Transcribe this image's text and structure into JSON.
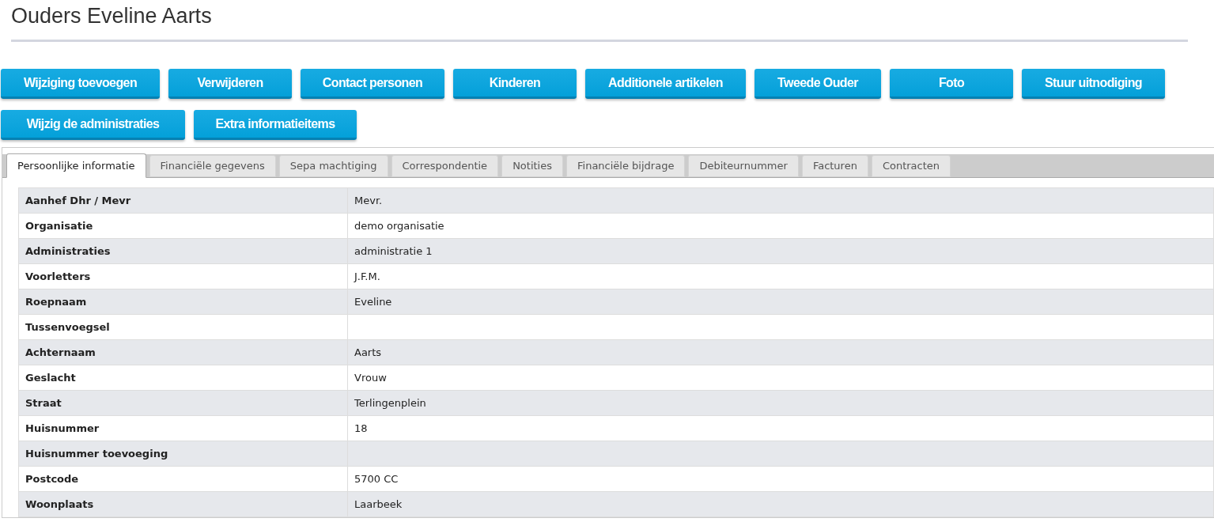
{
  "page": {
    "title": "Ouders Eveline Aarts"
  },
  "actions": [
    {
      "label": "Wijziging toevoegen"
    },
    {
      "label": "Verwijderen"
    },
    {
      "label": "Contact personen"
    },
    {
      "label": "Kinderen"
    },
    {
      "label": "Additionele artikelen"
    },
    {
      "label": "Tweede Ouder"
    },
    {
      "label": "Foto"
    },
    {
      "label": "Stuur uitnodiging"
    },
    {
      "label": "Wijzig de administraties"
    },
    {
      "label": "Extra informatieitems"
    }
  ],
  "tabs": [
    {
      "label": "Persoonlijke informatie",
      "selected": true
    },
    {
      "label": "Financiële gegevens",
      "selected": false
    },
    {
      "label": "Sepa machtiging",
      "selected": false
    },
    {
      "label": "Correspondentie",
      "selected": false
    },
    {
      "label": "Notities",
      "selected": false
    },
    {
      "label": "Financiële bijdrage",
      "selected": false
    },
    {
      "label": "Debiteurnummer",
      "selected": false
    },
    {
      "label": "Facturen",
      "selected": false
    },
    {
      "label": "Contracten",
      "selected": false
    }
  ],
  "details": [
    {
      "label": "Aanhef Dhr / Mevr",
      "value": "Mevr."
    },
    {
      "label": "Organisatie",
      "value": "demo organisatie"
    },
    {
      "label": "Administraties",
      "value": "administratie 1"
    },
    {
      "label": "Voorletters",
      "value": "J.F.M."
    },
    {
      "label": "Roepnaam",
      "value": "Eveline"
    },
    {
      "label": "Tussenvoegsel"
    },
    {
      "label": "Achternaam",
      "value": "Aarts"
    },
    {
      "label": "Geslacht",
      "value": "Vrouw"
    },
    {
      "label": "Straat",
      "value": "Terlingenplein"
    },
    {
      "label": "Huisnummer",
      "value": "18"
    },
    {
      "label": "Huisnummer toevoeging"
    },
    {
      "label": "Postcode",
      "value": "5700 CC"
    },
    {
      "label": "Woonplaats",
      "value": "Laarbeek"
    }
  ]
}
